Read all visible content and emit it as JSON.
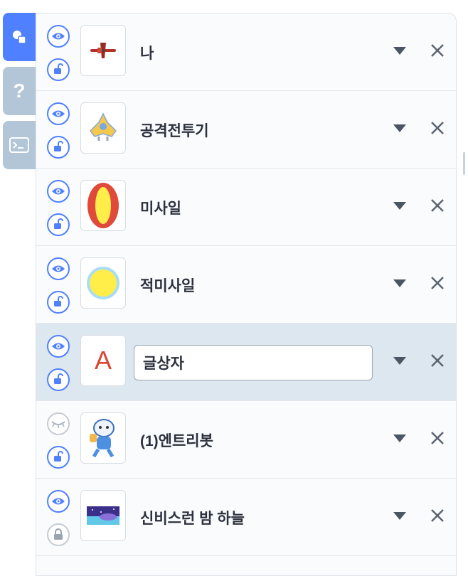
{
  "side_tabs": [
    {
      "name": "object-tab",
      "state": "active",
      "icon": "shapes-icon"
    },
    {
      "name": "help-tab",
      "state": "inactive",
      "icon": "question-icon",
      "glyph": "?"
    },
    {
      "name": "console-tab",
      "state": "inactive",
      "icon": "terminal-icon"
    }
  ],
  "objects": [
    {
      "label": "나",
      "visible": true,
      "locked": false,
      "thumb": "red-airplane",
      "selected": false
    },
    {
      "label": "공격전투기",
      "visible": true,
      "locked": false,
      "thumb": "fighter-jet",
      "selected": false
    },
    {
      "label": "미사일",
      "visible": true,
      "locked": false,
      "thumb": "missile-oval",
      "selected": false
    },
    {
      "label": "적미사일",
      "visible": true,
      "locked": false,
      "thumb": "yellow-circle",
      "selected": false
    },
    {
      "label": "글상자",
      "visible": true,
      "locked": false,
      "thumb": "text-box",
      "thumb_glyph": "A",
      "selected": true
    },
    {
      "label": "(1)엔트리봇",
      "visible": false,
      "locked": false,
      "thumb": "entrybot",
      "selected": false
    },
    {
      "label": "신비스런 밤 하늘",
      "visible": true,
      "locked": true,
      "thumb": "night-sky",
      "selected": false
    }
  ],
  "colors": {
    "accent": "#4f80ff",
    "selected_row": "#dde7f0",
    "text": "#2c313d"
  }
}
